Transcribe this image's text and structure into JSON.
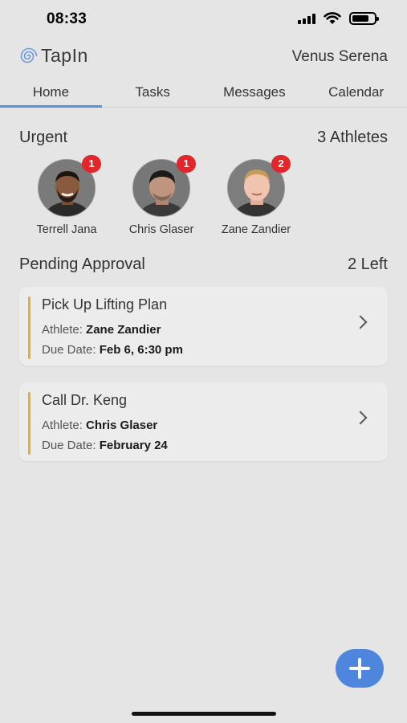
{
  "status_bar": {
    "time": "08:33"
  },
  "header": {
    "app_name": "TapIn",
    "user_name": "Venus Serena"
  },
  "tabs": [
    {
      "label": "Home",
      "active": true
    },
    {
      "label": "Tasks",
      "active": false
    },
    {
      "label": "Messages",
      "active": false
    },
    {
      "label": "Calendar",
      "active": false
    }
  ],
  "urgent": {
    "title": "Urgent",
    "count_label": "3 Athletes",
    "athletes": [
      {
        "name": "Terrell Jana",
        "badge": "1"
      },
      {
        "name": "Chris Glaser",
        "badge": "1"
      },
      {
        "name": "Zane Zandier",
        "badge": "2"
      }
    ]
  },
  "pending": {
    "title": "Pending Approval",
    "count_label": "2 Left",
    "athlete_prefix": "Athlete:",
    "due_prefix": "Due Date:",
    "tasks": [
      {
        "title": "Pick Up Lifting Plan",
        "athlete": "Zane Zandier",
        "due": "Feb 6, 6:30 pm"
      },
      {
        "title": "Call Dr. Keng",
        "athlete": "Chris Glaser",
        "due": "February 24"
      }
    ]
  },
  "colors": {
    "accent": "#5b8fd9",
    "fab": "#4d86dc",
    "badge": "#e0272c",
    "task_bar": "#e0b42a",
    "background": "#e5e5e5"
  },
  "icons": {
    "fab": "plus-icon",
    "card_action": "chevron-right-icon",
    "logo": "spiral-logo-icon"
  }
}
